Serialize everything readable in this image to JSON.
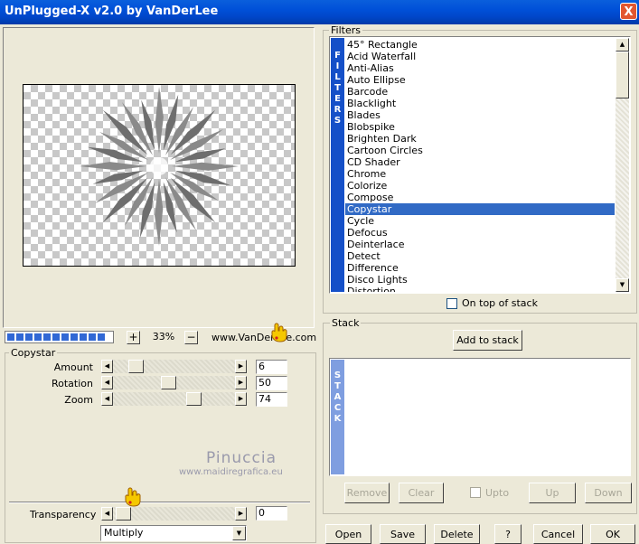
{
  "window": {
    "title": "UnPlugged-X v2.0 by VanDerLee",
    "close": "X"
  },
  "preview": {
    "zoom_minus": "−",
    "zoom_plus": "+",
    "zoom_value": "33%",
    "website": "www.VanDerLee.com",
    "progress_percent": 100
  },
  "settings": {
    "group_label": "Copystar",
    "sliders": [
      {
        "label": "Amount",
        "value": "6"
      },
      {
        "label": "Rotation",
        "value": "50"
      },
      {
        "label": "Zoom",
        "value": "74"
      }
    ],
    "transparency_label": "Transparency",
    "transparency_value": "0",
    "blend_mode": "Multiply"
  },
  "watermark": {
    "name": "Pinuccia",
    "url": "www.maidiregrafica.eu"
  },
  "filters": {
    "group_label": "Filters",
    "sidebar_letters": [
      "F",
      "I",
      "L",
      "T",
      "E",
      "R",
      "S"
    ],
    "items": [
      "45° Rectangle",
      "Acid Waterfall",
      "Anti-Alias",
      "Auto Ellipse",
      "Barcode",
      "Blacklight",
      "Blades",
      "Blobspike",
      "Brighten Dark",
      "Cartoon Circles",
      "CD Shader",
      "Chrome",
      "Colorize",
      "Compose",
      "Copystar",
      "Cycle",
      "Defocus",
      "Deinterlace",
      "Detect",
      "Difference",
      "Disco Lights",
      "Distortion"
    ],
    "selected_index": 14,
    "on_top_label": "On top of stack"
  },
  "stack": {
    "group_label": "Stack",
    "add_button": "Add to stack",
    "sidebar_letters": [
      "S",
      "T",
      "A",
      "C",
      "K"
    ],
    "remove": "Remove",
    "clear": "Clear",
    "upto": "Upto",
    "up": "Up",
    "down": "Down"
  },
  "footer": {
    "open": "Open",
    "save": "Save",
    "delete": "Delete",
    "help": "?",
    "cancel": "Cancel",
    "ok": "OK"
  },
  "colors": {
    "titlebar": "#0050d8",
    "selection": "#316ac5",
    "progress": "#3168d5",
    "filters_bar": "#1550c8"
  }
}
